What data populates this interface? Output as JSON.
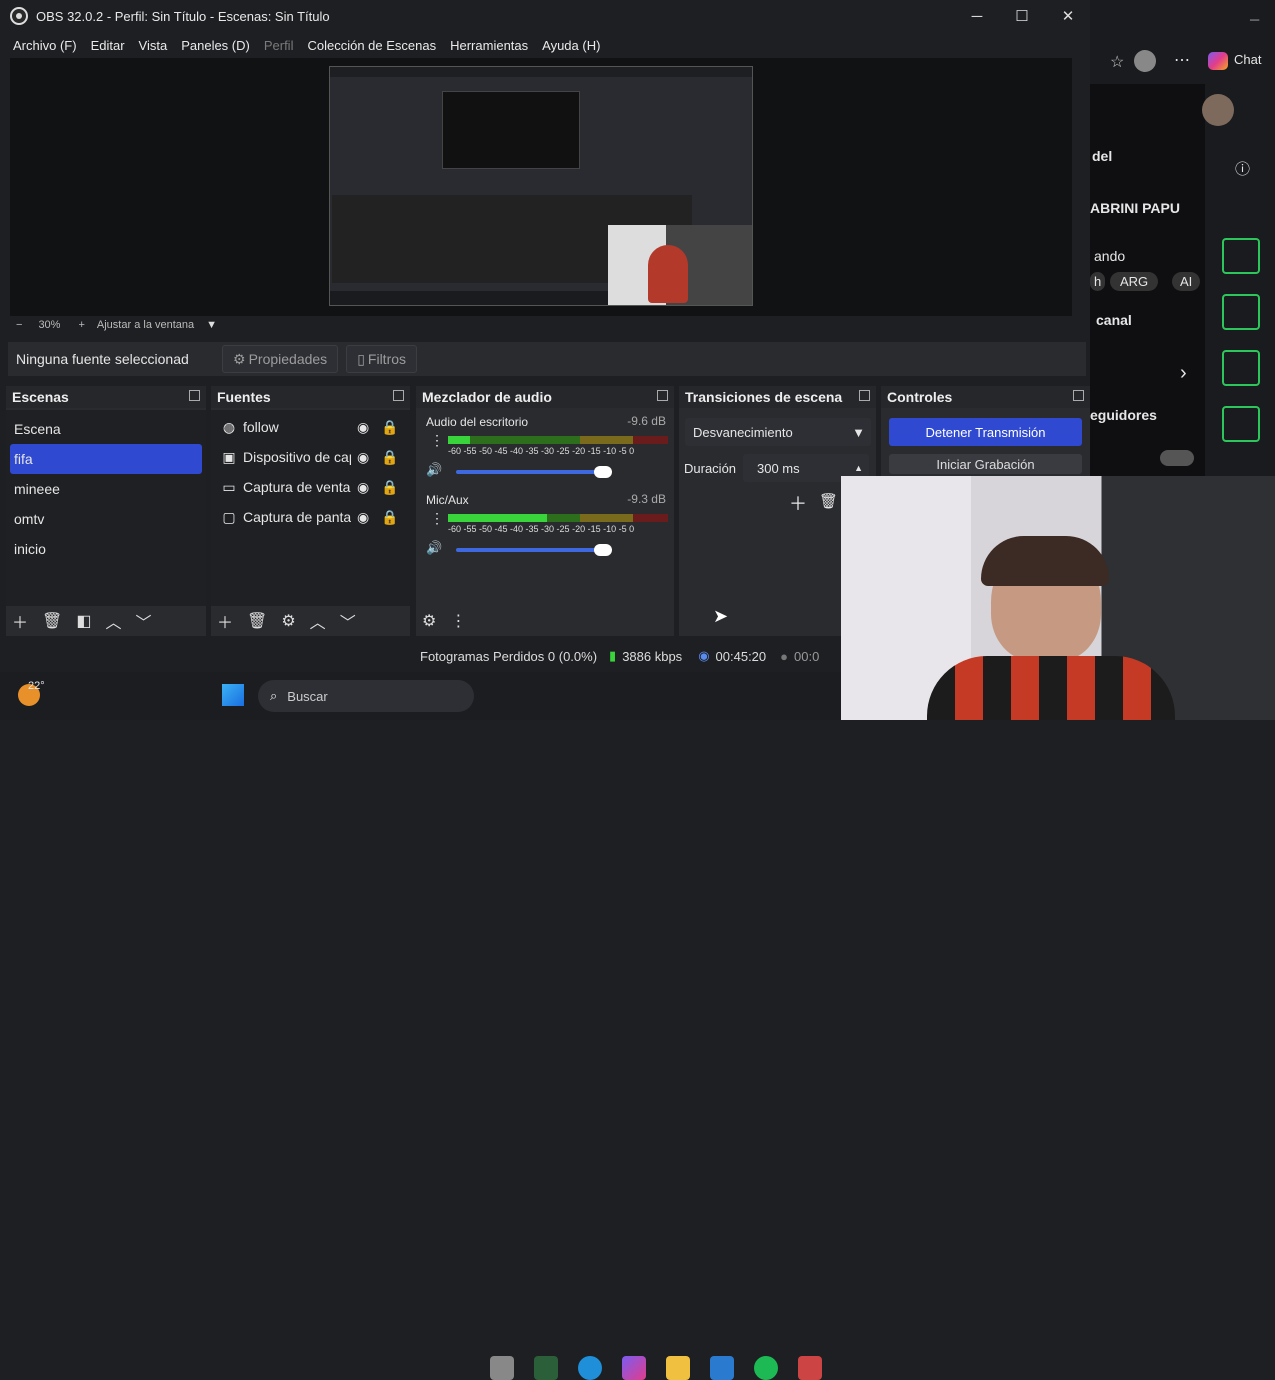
{
  "window": {
    "title": "OBS 32.0.2 - Perfil: Sin Título - Escenas: Sin Título",
    "min": "─",
    "max": "☐",
    "close": "✕"
  },
  "menu": [
    "Archivo (F)",
    "Editar",
    "Vista",
    "Paneles (D)",
    "Perfil",
    "Colección de Escenas",
    "Herramientas",
    "Ayuda (H)"
  ],
  "preview": {
    "zoom_minus": "−",
    "zoom_value": "30%",
    "zoom_plus": "+",
    "zoom_fit": "Ajustar a la ventana",
    "zoom_menu": "▼"
  },
  "source_bar": {
    "no_source": "Ninguna fuente seleccionad",
    "properties": "Propiedades",
    "filters": "Filtros"
  },
  "scenes": {
    "title": "Escenas",
    "items": [
      "Escena",
      "fifa",
      "mineee",
      "omtv",
      "inicio"
    ],
    "selected": "fifa"
  },
  "sources": {
    "title": "Fuentes",
    "items": [
      {
        "name": "follow",
        "icon": "globe-icon"
      },
      {
        "name": "Dispositivo de cap",
        "icon": "camera-icon"
      },
      {
        "name": "Captura de ventar",
        "icon": "window-icon"
      },
      {
        "name": "Captura de pantal",
        "icon": "monitor-icon"
      }
    ]
  },
  "mixer": {
    "title": "Mezclador de audio",
    "tracks": [
      {
        "name": "Audio del escritorio",
        "db": "-9.6 dB",
        "level": 0.1,
        "volume": 0.95
      },
      {
        "name": "Mic/Aux",
        "db": "-9.3 dB",
        "level": 0.45,
        "volume": 0.95
      }
    ],
    "scale": "-60 -55 -50 -45 -40 -35 -30 -25 -20 -15 -10  -5  0"
  },
  "transitions": {
    "title": "Transiciones de escena",
    "selected": "Desvanecimiento",
    "duration_label": "Duración",
    "duration_value": "300 ms"
  },
  "controls": {
    "title": "Controles",
    "stop_stream": "Detener Transmisión",
    "start_record": "Iniciar Grabación"
  },
  "status": {
    "dropped": "Fotogramas Perdidos 0 (0.0%)",
    "bitrate": "3886 kbps",
    "live_time": "00:45:20",
    "rec_time": "00:0"
  },
  "browser": {
    "chat": "Chat",
    "frag1": "del",
    "name": "ABRINI PAPU",
    "frag2": "ando",
    "tag1": "h",
    "tag2": "ARG",
    "tag3": "AI",
    "canal": "canal",
    "seguidores": "eguidores"
  },
  "taskbar": {
    "temp": "22°",
    "search": "Buscar"
  },
  "colors": {
    "accent": "#2f49d1",
    "live": "#39d33b"
  }
}
